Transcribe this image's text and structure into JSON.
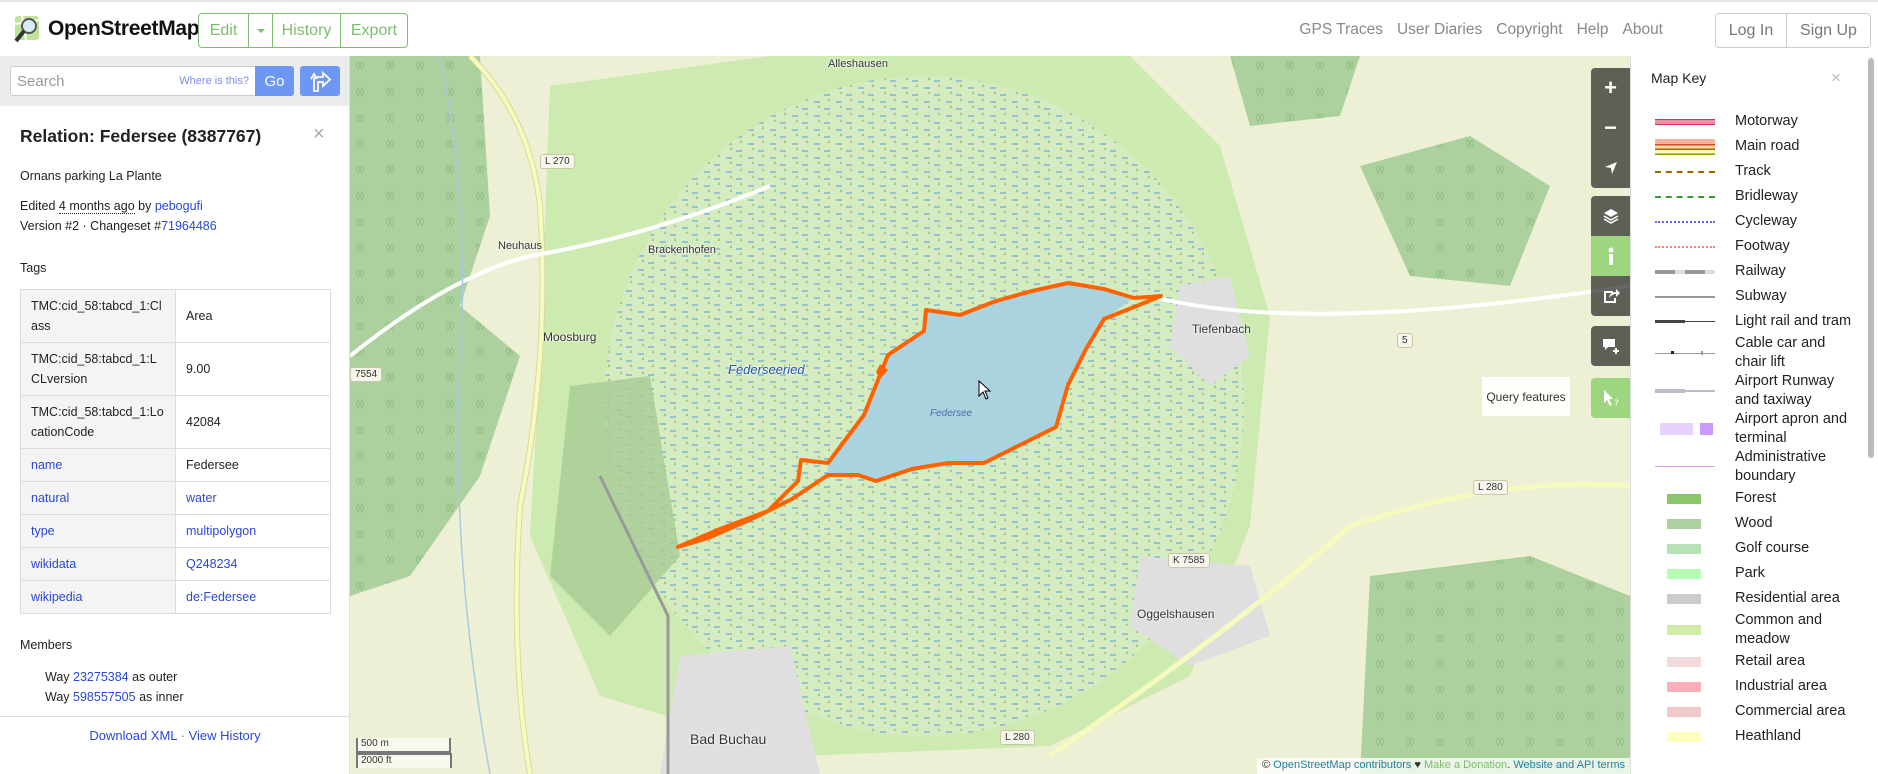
{
  "header": {
    "brand": "OpenStreetMap",
    "edit": "Edit",
    "history": "History",
    "export": "Export",
    "nav": [
      "GPS Traces",
      "User Diaries",
      "Copyright",
      "Help",
      "About"
    ],
    "login": "Log In",
    "signup": "Sign Up"
  },
  "search": {
    "placeholder": "Search",
    "where": "Where is this?",
    "go": "Go"
  },
  "feature": {
    "title": "Relation: Federsee (8387767)",
    "close": "×",
    "comment": "Ornans parking La Plante",
    "edited_prefix": "Edited ",
    "edited_time": "4 months ago",
    "edited_by": " by ",
    "user": "pebogufi",
    "version": "Version #2 · Changeset #",
    "changeset": "71964486",
    "tags_heading": "Tags",
    "tags": [
      {
        "k": "TMC:cid_58:tabcd_1:Class",
        "v": "Area",
        "klink": false,
        "vlink": false
      },
      {
        "k": "TMC:cid_58:tabcd_1:LCLversion",
        "v": "9.00",
        "klink": false,
        "vlink": false
      },
      {
        "k": "TMC:cid_58:tabcd_1:LocationCode",
        "v": "42084",
        "klink": false,
        "vlink": false
      },
      {
        "k": "name",
        "v": "Federsee",
        "klink": true,
        "vlink": false
      },
      {
        "k": "natural",
        "v": "water",
        "klink": true,
        "vlink": true
      },
      {
        "k": "type",
        "v": "multipolygon",
        "klink": true,
        "vlink": true
      },
      {
        "k": "wikidata",
        "v": "Q248234",
        "klink": true,
        "vlink": true
      },
      {
        "k": "wikipedia",
        "v": "de:Federsee",
        "klink": true,
        "vlink": true
      }
    ],
    "members_heading": "Members",
    "members": [
      {
        "type": "Way ",
        "id": "23275384",
        "role": " as outer"
      },
      {
        "type": "Way ",
        "id": "598557505",
        "role": " as inner"
      }
    ],
    "download_xml": "Download XML",
    "sep": " · ",
    "view_history": "View History"
  },
  "map": {
    "labels": {
      "alleshausen": "Alleshausen",
      "l270": "L 270",
      "neuhaus": "Neuhaus",
      "brackenhofen": "Brackenhofen",
      "moosburg": "Moosburg",
      "federseeried": "Federseeried",
      "federsee": "Federsee",
      "tiefenbach": "Tiefenbach",
      "r5": "5",
      "l280a": "L 280",
      "k7585": "K 7585",
      "oggelshausen": "Oggelshausen",
      "badbuchau": "Bad Buchau",
      "l280b": "L 280",
      "r7554": "7554"
    },
    "query_tooltip": "Query features",
    "scale_m": "500 m",
    "scale_ft": "2000 ft",
    "attribution": {
      "copy": "© ",
      "contributors": "OpenStreetMap contributors",
      "heart": " ♥ ",
      "donate": "Make a Donation",
      "dot": ". ",
      "terms": "Website and API terms"
    },
    "highlight_color": "#ff6200",
    "water_color": "#aad3df"
  },
  "controls": [
    "zoom-in-icon",
    "zoom-out-icon",
    "locate-icon",
    "layers-icon",
    "info-icon",
    "share-icon",
    "add-note-icon",
    "query-icon"
  ],
  "map_key": {
    "title": "Map Key",
    "close": "×",
    "items": [
      {
        "label": "Motorway",
        "kind": "motorway",
        "color": "#e892a2"
      },
      {
        "label": "Main road",
        "kind": "mainroad",
        "color": "#fcd6a4"
      },
      {
        "label": "Track",
        "kind": "dash",
        "color": "#996600"
      },
      {
        "label": "Bridleway",
        "kind": "dash",
        "color": "#339933"
      },
      {
        "label": "Cycleway",
        "kind": "dot",
        "color": "#6666ff"
      },
      {
        "label": "Footway",
        "kind": "dot",
        "color": "#fa8072"
      },
      {
        "label": "Railway",
        "kind": "rail",
        "color": "#999999"
      },
      {
        "label": "Subway",
        "kind": "line",
        "color": "#999999"
      },
      {
        "label": "Light rail and tram",
        "kind": "tram",
        "color": "#444444"
      },
      {
        "label": "Cable car and chair lift",
        "kind": "cable",
        "color": "#999999"
      },
      {
        "label": "Airport Runway and taxiway",
        "kind": "runway",
        "color": "#bbbbcc"
      },
      {
        "label": "Airport apron and terminal",
        "kind": "apron",
        "color": "#e9d1ff"
      },
      {
        "label": "Administrative boundary",
        "kind": "thin",
        "color": "#d9a0e8"
      },
      {
        "label": "Forest",
        "kind": "fill",
        "color": "#8dc56c"
      },
      {
        "label": "Wood",
        "kind": "fill",
        "color": "#aed1a0"
      },
      {
        "label": "Golf course",
        "kind": "fill",
        "color": "#b5e3b5"
      },
      {
        "label": "Park",
        "kind": "fill",
        "color": "#b6fdb6"
      },
      {
        "label": "Residential area",
        "kind": "fill",
        "color": "#cccccc"
      },
      {
        "label": "Common and meadow",
        "kind": "fill",
        "color": "#cfeca8"
      },
      {
        "label": "Retail area",
        "kind": "fill",
        "color": "#f1dada"
      },
      {
        "label": "Industrial area",
        "kind": "fill",
        "color": "#ffaeb9"
      },
      {
        "label": "Commercial area",
        "kind": "fill",
        "color": "#efc8c8"
      },
      {
        "label": "Heathland",
        "kind": "fill",
        "color": "#ffffc0"
      }
    ]
  }
}
